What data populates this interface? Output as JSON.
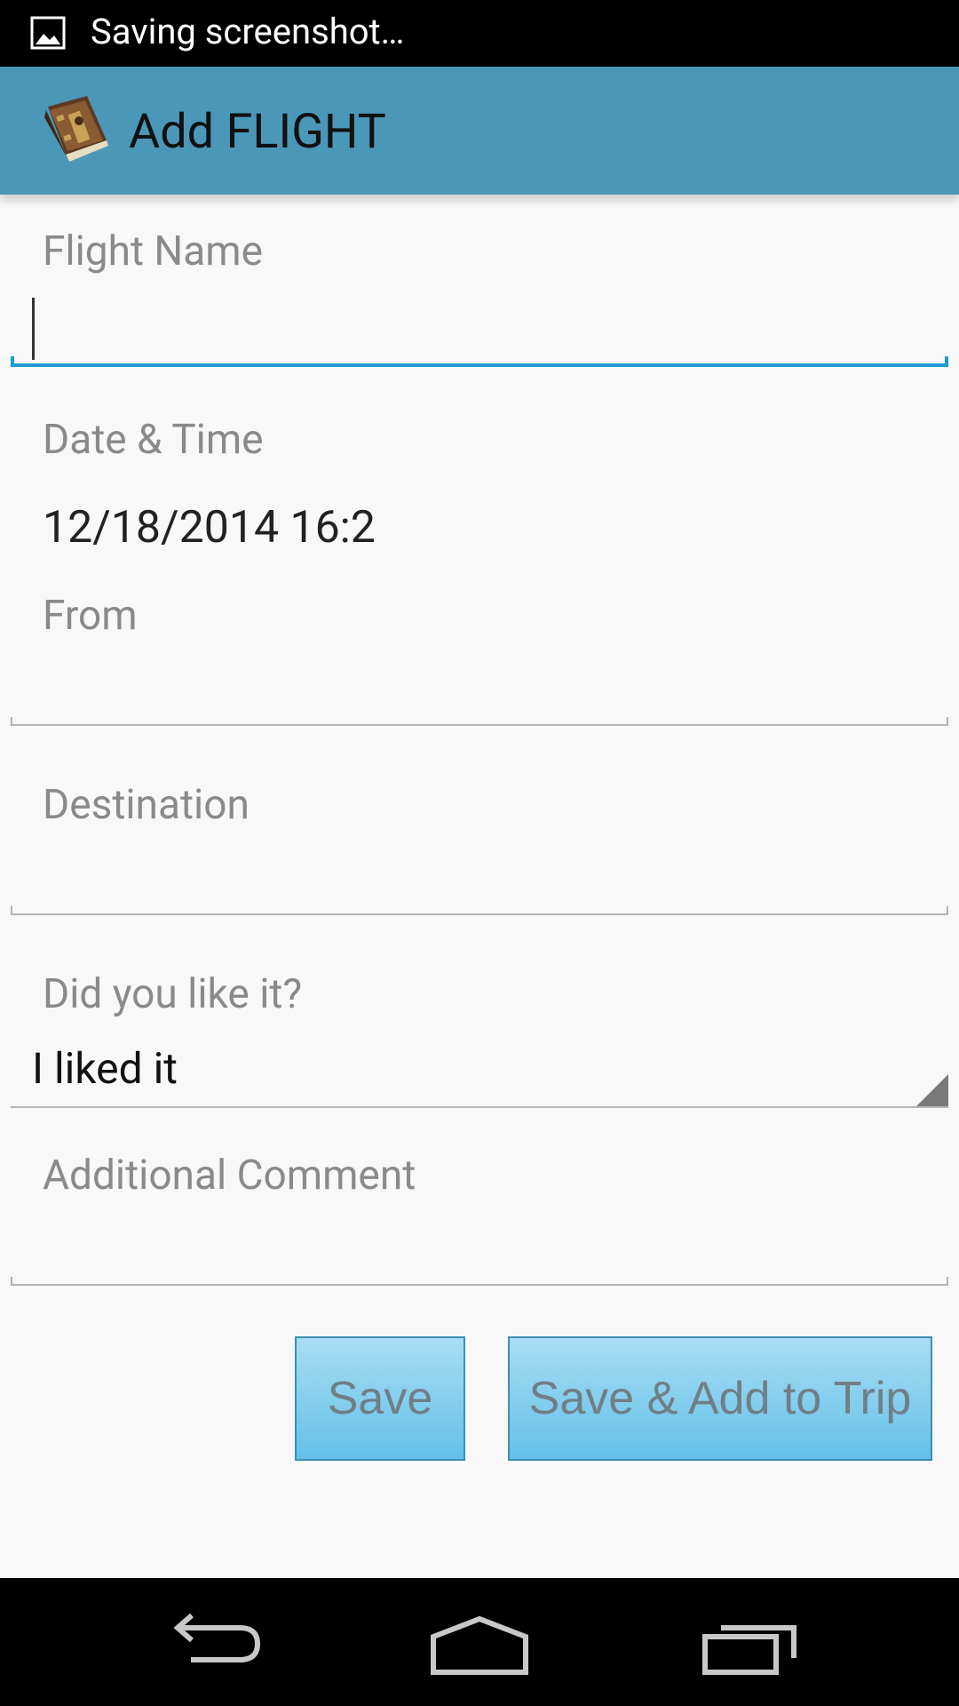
{
  "status_bar": {
    "notification_icon": "image-icon",
    "text": "Saving screenshot…"
  },
  "action_bar": {
    "app_icon": "journal-book-icon",
    "title": "Add FLIGHT"
  },
  "form": {
    "flight_name": {
      "label": "Flight Name",
      "value": ""
    },
    "date_time": {
      "label": "Date & Time",
      "value": "12/18/2014 16:2"
    },
    "from": {
      "label": "From",
      "value": ""
    },
    "destination": {
      "label": "Destination",
      "value": ""
    },
    "rating": {
      "label": "Did you like it?",
      "selected": "I liked it"
    },
    "comment": {
      "label": "Additional Comment",
      "value": ""
    }
  },
  "buttons": {
    "save": "Save",
    "save_add_trip": "Save & Add to Trip"
  },
  "nav_bar": {
    "back_icon": "back-icon",
    "home_icon": "home-icon",
    "recents_icon": "recent-apps-icon"
  },
  "colors": {
    "action_bar": "#4b97b8",
    "focus_underline": "#1e9ad4",
    "button_gradient_top": "#a9ddf3",
    "button_gradient_bottom": "#63c0e8"
  }
}
